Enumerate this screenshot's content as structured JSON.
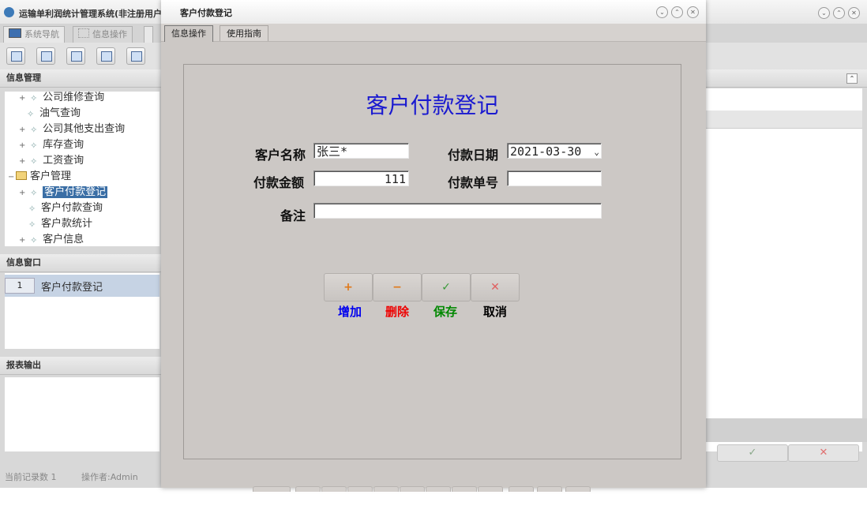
{
  "main": {
    "title": "运输单利润统计管理系统(非注册用户",
    "tabs": [
      {
        "label": "系统导航"
      },
      {
        "label": "信息操作"
      }
    ],
    "info_panel_title": "信息管理",
    "tree": [
      {
        "label": "公司维修查询"
      },
      {
        "label": "油气查询"
      },
      {
        "label": "公司其他支出查询"
      },
      {
        "label": "库存查询"
      },
      {
        "label": "工资查询"
      },
      {
        "label": "客户管理"
      },
      {
        "label": "客户付款登记"
      },
      {
        "label": "客户付款查询"
      },
      {
        "label": "客户款统计"
      },
      {
        "label": "客户信息"
      }
    ],
    "window_panel_title": "信息窗口",
    "window_rows": [
      {
        "index": "1",
        "label": "客户付款登记"
      }
    ],
    "report_panel_title": "报表输出",
    "status": {
      "record_count": "当前记录数 1",
      "operator": "操作者:Admin"
    },
    "right_buttons": {
      "save_icon": "✓",
      "cancel_icon": "✕"
    }
  },
  "dialog": {
    "title": "客户付款登记",
    "tabs": [
      {
        "label": "信息操作"
      },
      {
        "label": "使用指南"
      }
    ],
    "form_title": "客户付款登记",
    "fields": {
      "customer_name": {
        "label": "客户名称",
        "value": "张三*"
      },
      "payment_date": {
        "label": "付款日期",
        "value": "2021-03-30"
      },
      "amount": {
        "label": "付款金额",
        "value": "111"
      },
      "payment_no": {
        "label": "付款单号",
        "value": ""
      },
      "remark": {
        "label": "备注",
        "value": ""
      }
    },
    "actions": {
      "add": {
        "icon": "+",
        "label": "增加",
        "color": "#0000ee"
      },
      "delete": {
        "icon": "−",
        "label": "删除",
        "color": "#ee0000"
      },
      "save": {
        "icon": "✓",
        "label": "保存",
        "color": "#008800"
      },
      "cancel": {
        "icon": "✕",
        "label": "取消",
        "color": "#000000"
      }
    }
  }
}
